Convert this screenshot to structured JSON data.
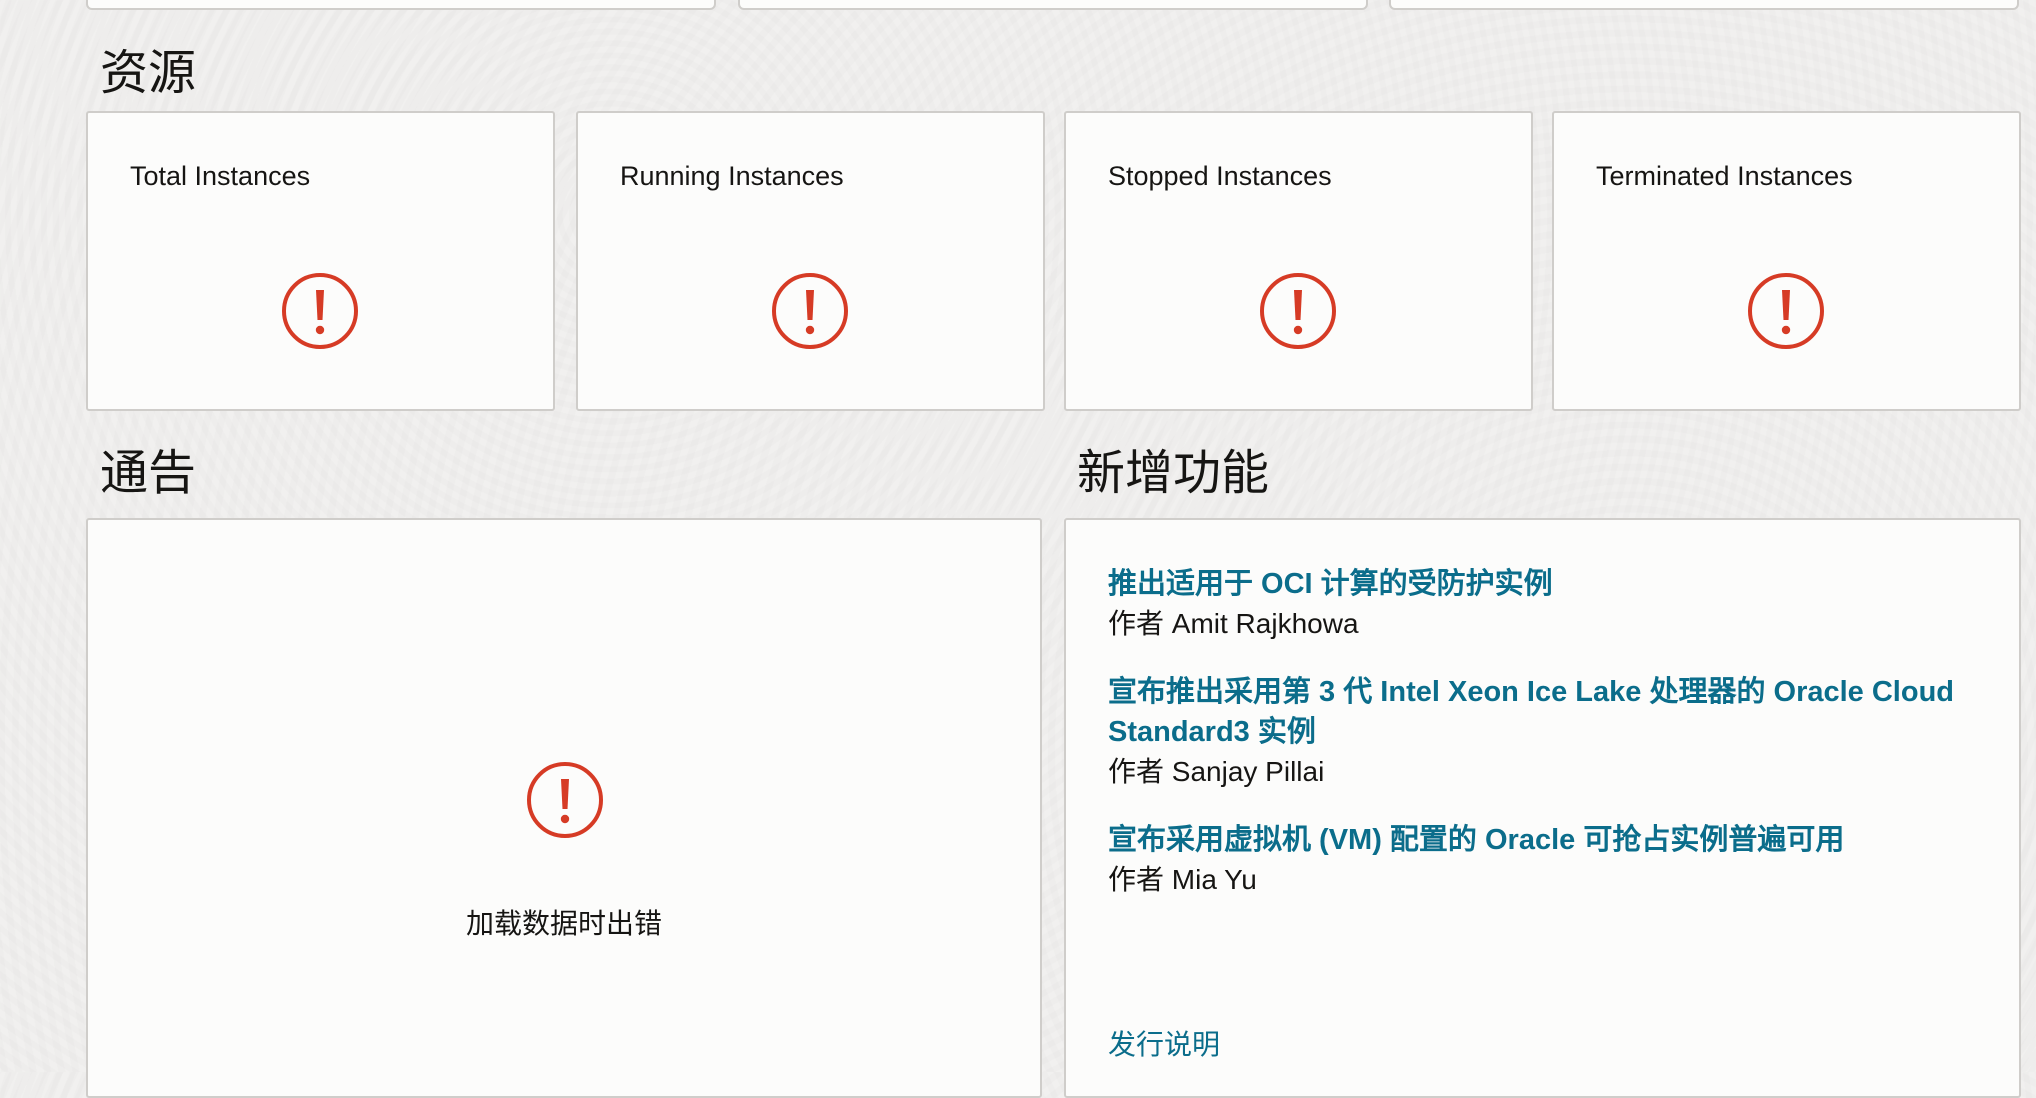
{
  "resources": {
    "heading": "资源",
    "cards": [
      {
        "title": "Total Instances"
      },
      {
        "title": "Running Instances"
      },
      {
        "title": "Stopped Instances"
      },
      {
        "title": "Terminated Instances"
      }
    ]
  },
  "announcements": {
    "heading": "通告",
    "error_message": "加载数据时出错"
  },
  "whats_new": {
    "heading": "新增功能",
    "items": [
      {
        "title": "推出适用于 OCI 计算的受防护实例",
        "author": "作者 Amit Rajkhowa"
      },
      {
        "title": "宣布推出采用第 3 代 Intel Xeon Ice Lake 处理器的 Oracle Cloud Standard3 实例",
        "author": "作者 Sanjay Pillai"
      },
      {
        "title": "宣布采用虚拟机 (VM) 配置的 Oracle 可抢占实例普遍可用",
        "author": "作者 Mia Yu"
      }
    ],
    "release_notes_label": "发行说明"
  },
  "colors": {
    "link": "#0b6d8b",
    "error": "#d63b25",
    "card_bg": "#fcfcfb",
    "card_border": "#cfcdca",
    "page_bg": "#f1f0ef"
  },
  "icons": {
    "error": "exclamation-circle-icon"
  }
}
